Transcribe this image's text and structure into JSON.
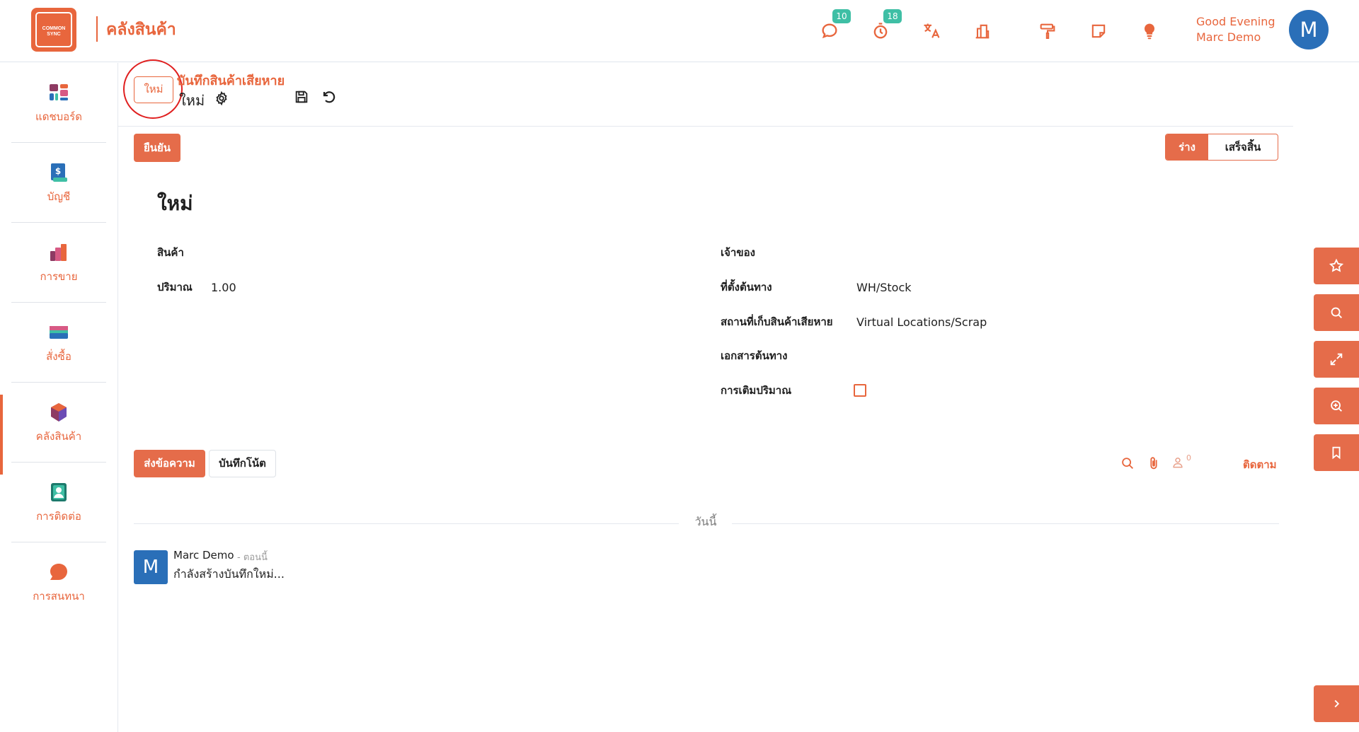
{
  "app": {
    "logo_text_1": "COMMON",
    "logo_text_2": "SYNC",
    "title": "คลังสินค้า"
  },
  "topbar": {
    "messages_count": "10",
    "activities_count": "18",
    "greeting_line1": "Good Evening",
    "greeting_line2": "Marc Demo",
    "avatar_letter": "M",
    "icons": [
      "chat-icon",
      "clock-icon",
      "translate-icon",
      "company-icon",
      "paint-roller-icon",
      "sticky-note-icon",
      "lightbulb-icon"
    ]
  },
  "sidebar": {
    "items": [
      {
        "label": "แดชบอร์ด",
        "icon": "dashboard-icon"
      },
      {
        "label": "บัญชี",
        "icon": "accounting-icon"
      },
      {
        "label": "การขาย",
        "icon": "sales-icon"
      },
      {
        "label": "สั่งซื้อ",
        "icon": "purchase-icon"
      },
      {
        "label": "คลังสินค้า",
        "icon": "inventory-icon",
        "active": true
      },
      {
        "label": "การติดต่อ",
        "icon": "contacts-icon"
      },
      {
        "label": "การสนทนา",
        "icon": "discuss-icon"
      }
    ]
  },
  "header": {
    "new_button": "ใหม่",
    "breadcrumb_parent": "บันทึกสินค้าเสียหาย",
    "breadcrumb_current": "ใหม่"
  },
  "statusbar": {
    "confirm_label": "ยืนยัน",
    "draft_label": "ร่าง",
    "done_label": "เสร็จสิ้น",
    "active_state": "draft"
  },
  "form": {
    "title": "ใหม่",
    "left": {
      "product_label": "สินค้า",
      "product_value": "",
      "quantity_label": "ปริมาณ",
      "quantity_value": "1.00"
    },
    "right": {
      "owner_label": "เจ้าของ",
      "owner_value": "",
      "source_location_label": "ที่ตั้งต้นทาง",
      "source_location_value": "WH/Stock",
      "scrap_location_label": "สถานที่เก็บสินค้าเสียหาย",
      "scrap_location_value": "Virtual Locations/Scrap",
      "source_document_label": "เอกสารต้นทาง",
      "source_document_value": "",
      "replenish_label": "การเติมปริมาณ",
      "replenish_checked": false
    }
  },
  "chatter": {
    "send_message_label": "ส่งข้อความ",
    "log_note_label": "บันทึกโน้ต",
    "followers_count": "0",
    "follow_label": "ติดตาม",
    "day_separator": "วันนี้",
    "messages": [
      {
        "avatar": "M",
        "author": "Marc Demo",
        "time": "- ตอนนี้",
        "body": "กำลังสร้างบันทึกใหม่..."
      }
    ]
  },
  "floating_buttons": [
    "star-icon",
    "search-icon",
    "expand-icon",
    "zoom-in-icon",
    "bookmark-icon",
    "chevron-right-icon"
  ],
  "colors": {
    "accent": "#e8663d",
    "button_fill": "#e56c4a",
    "badge": "#3fbfa5",
    "avatar": "#2a6fb8"
  }
}
